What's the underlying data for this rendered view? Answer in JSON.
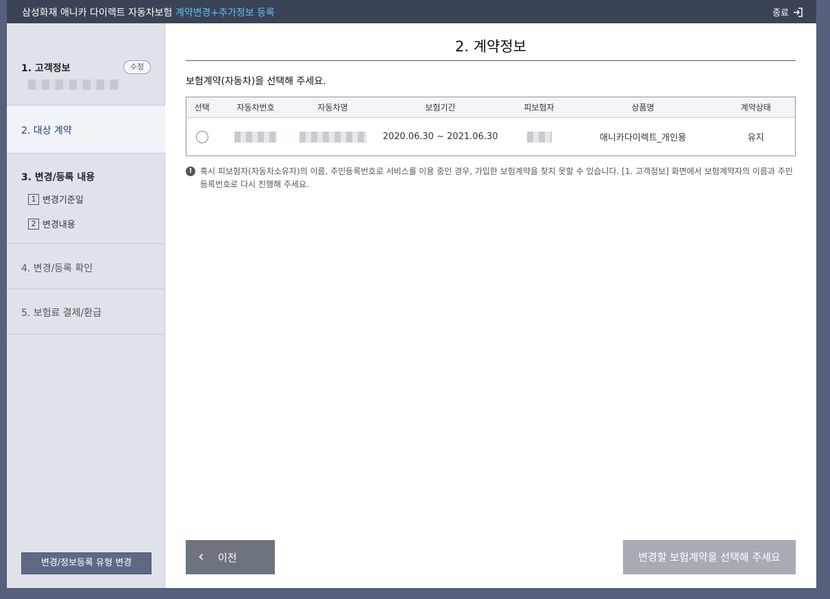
{
  "header": {
    "title_main": "삼성화재 애니카 다이렉트 자동차보험",
    "title_highlight": "계약변경+추가정보 등록",
    "close_label": "종료"
  },
  "sidebar": {
    "step1": {
      "label": "1. 고객정보",
      "edit_label": "수정"
    },
    "step2": {
      "label": "2. 대상 계약"
    },
    "step3": {
      "label": "3. 변경/등록 내용",
      "subs": [
        {
          "num": "1",
          "label": "변경기준일"
        },
        {
          "num": "2",
          "label": "변경내용"
        }
      ]
    },
    "step4": {
      "label": "4. 변경/등록 확인"
    },
    "step5": {
      "label": "5. 보험료 결제/환급"
    },
    "type_change_button": "변경/정보등록 유형 변경"
  },
  "main": {
    "title": "2. 계약정보",
    "lead": "보험계약(자동차)을 선택해 주세요.",
    "table": {
      "headers": [
        "선택",
        "자동차번호",
        "자동차명",
        "보험기간",
        "피보험자",
        "상품명",
        "계약상태"
      ],
      "rows": [
        {
          "period": "2020.06.30 ~ 2021.06.30",
          "product": "애니카다이렉트_개인용",
          "status": "유지"
        }
      ]
    },
    "notice": "혹시 피보험자(자동차소유자)의 이름, 주민등록번호로 서비스를 이용 중인 경우, 가입한 보험계약을 찾지 못할 수 있습니다. [1. 고객정보] 화면에서 보험계약자의 이름과 주민등록번호로 다시 진행해 주세요.",
    "prev_button": "이전",
    "next_button": "변경할 보험계약을 선택해 주세요"
  },
  "colors": {
    "topbar": "#3b4356",
    "highlight": "#5bc0ff",
    "sidebar": "#dfe2e8",
    "active_step_text": "#1f3f7a",
    "prev_button": "#6e747e",
    "next_button_disabled": "#a6abb4"
  }
}
